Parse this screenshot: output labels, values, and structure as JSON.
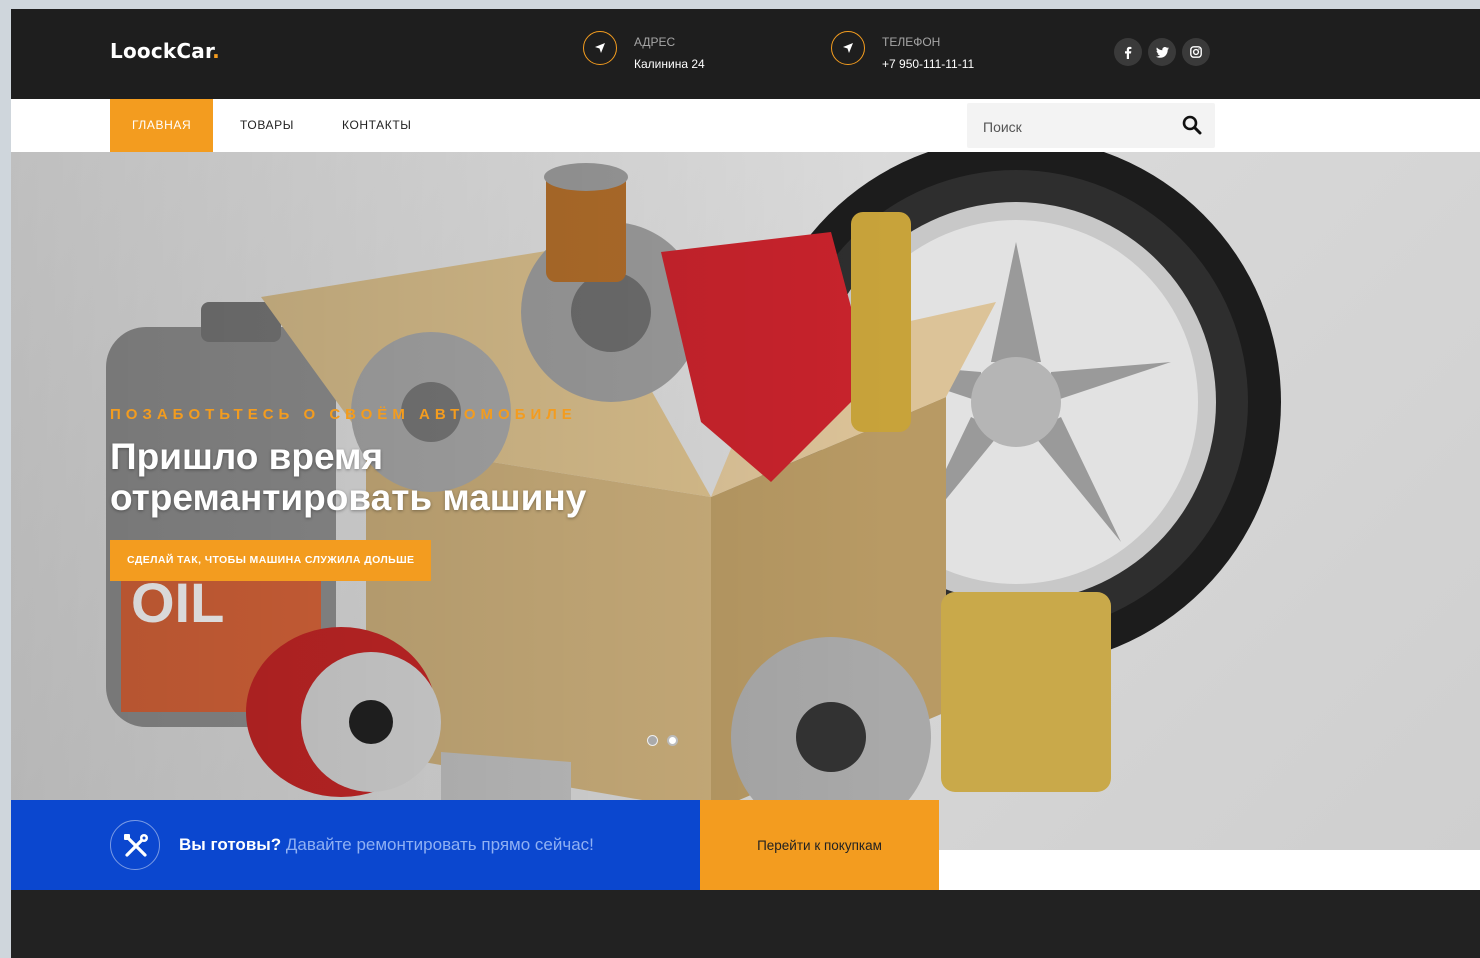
{
  "brand": {
    "name": "LoockCar",
    "dot": "."
  },
  "topbar": {
    "address": {
      "label": "АДРЕС",
      "value": "Калинина 24",
      "icon": "location-arrow-icon"
    },
    "phone": {
      "label": "ТЕЛЕФОН",
      "value": "+7 950-111-11-11",
      "icon": "location-arrow-icon"
    },
    "social": [
      {
        "name": "facebook",
        "glyph": "f"
      },
      {
        "name": "twitter",
        "glyph": "t"
      },
      {
        "name": "instagram",
        "glyph": "◎"
      }
    ]
  },
  "nav": {
    "items": [
      {
        "label": "ГЛАВНАЯ",
        "active": true
      },
      {
        "label": "ТОВАРЫ",
        "active": false
      },
      {
        "label": "КОНТАКТЫ",
        "active": false
      }
    ],
    "search": {
      "placeholder": "Поиск",
      "icon": "search-icon"
    }
  },
  "hero": {
    "kicker": "ПОЗАБОТЬТЕСЬ О СВОЁМ АВТОМОБИЛЕ",
    "title_line1": "Пришло время",
    "title_line2": "отремантировать машину",
    "cta": "СДЕЛАЙ ТАК, ЧТОБЫ МАШИНА СЛУЖИЛА ДОЛЬШЕ",
    "slides": {
      "count": 2,
      "active_index": 1
    }
  },
  "promo": {
    "icon": "tools-icon",
    "strong": "Вы готовы?",
    "light": " Давайте ремонтировать прямо сейчас!",
    "button": "Перейти к покупкам"
  },
  "colors": {
    "accent": "#f39c1f",
    "blue": "#0b47cf",
    "dark": "#1e1e1e"
  }
}
